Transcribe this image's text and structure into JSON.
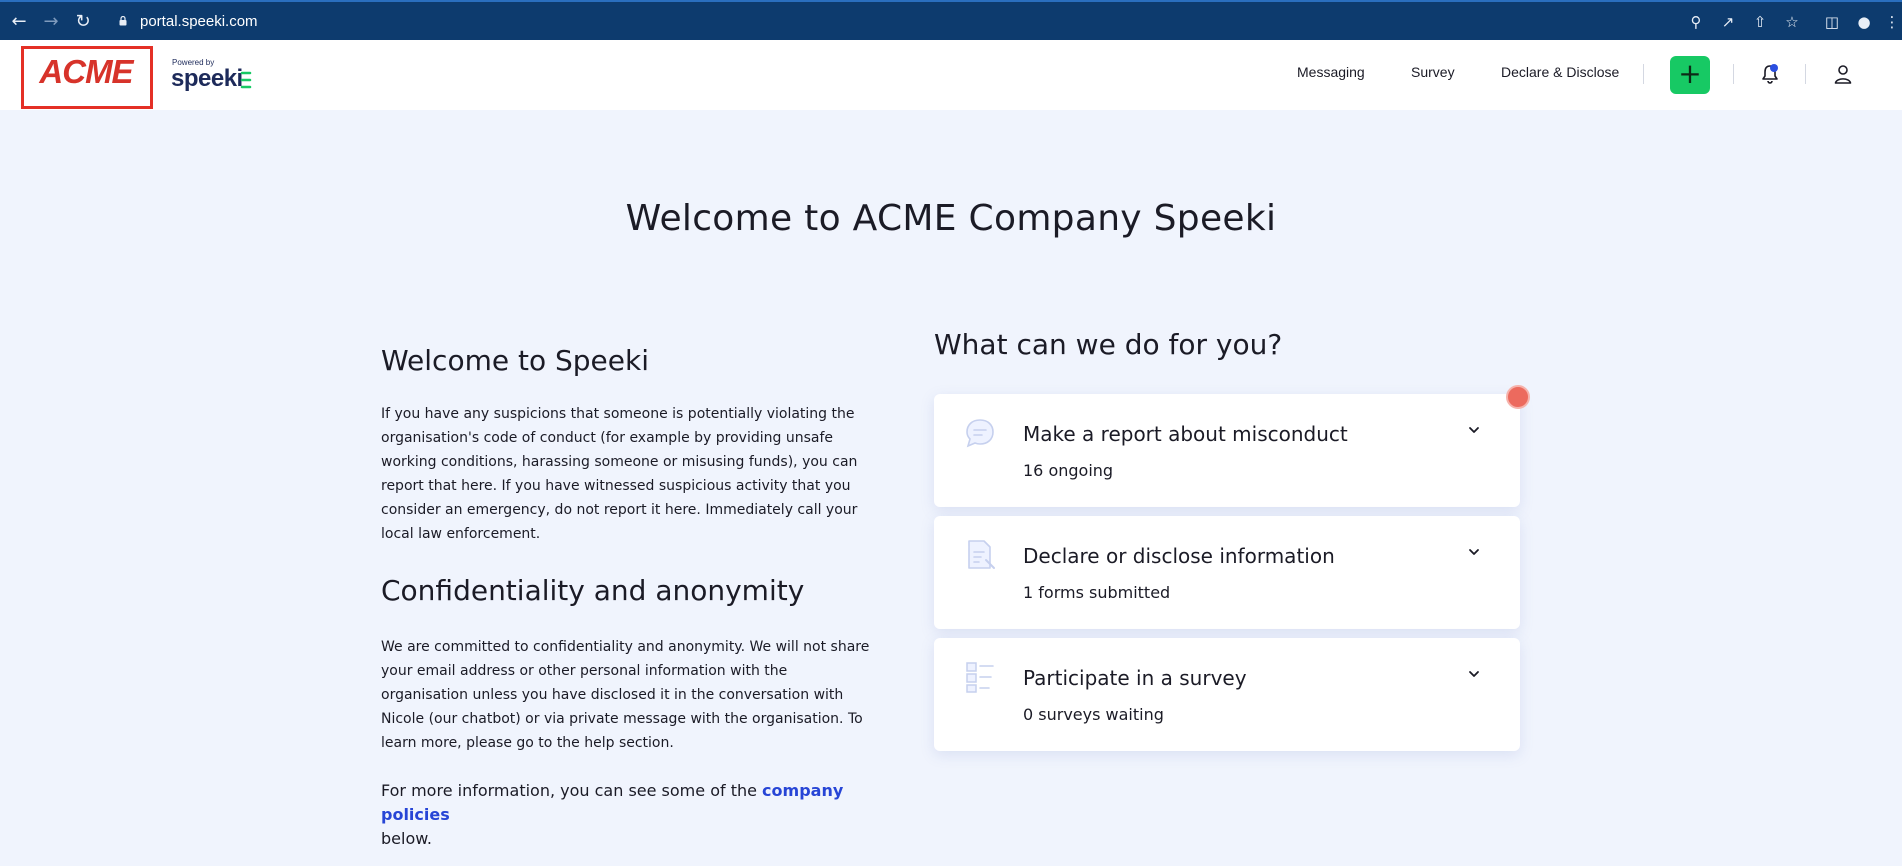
{
  "browser": {
    "url": "portal.speeki.com"
  },
  "header": {
    "logo_text": "ACME",
    "powered_by": "Powered by",
    "brand": "speeki",
    "nav": [
      "Messaging",
      "Survey",
      "Declare & Disclose"
    ],
    "add_label": "+"
  },
  "page": {
    "title": "Welcome to ACME Company Speeki"
  },
  "left": {
    "welcome_heading": "Welcome to Speeki",
    "welcome_text": "If you have any suspicions that someone is potentially violating the organisation's code of conduct (for example by providing unsafe working conditions, harassing someone or misusing funds), you can report that here. If you have witnessed suspicious activity that you consider an emergency, do not report it here. Immediately call your local law enforcement.",
    "conf_heading": "Confidentiality and anonymity",
    "conf_text": "We are committed to confidentiality and anonymity. We will not share your email address or other personal information with the organisation unless you have disclosed it in the conversation with Nicole (our chatbot) or via private message with the organisation. To learn more, please go to the help section.",
    "more_prefix": "For more information, you can see some of the ",
    "more_link": "company policies",
    "more_suffix": "below."
  },
  "right": {
    "title": "What can we do for you?",
    "cards": [
      {
        "title": "Make a report about misconduct",
        "sub": "16 ongoing",
        "icon": "chat-bubble-icon"
      },
      {
        "title": "Declare or disclose information",
        "sub": "1 forms submitted",
        "icon": "document-edit-icon"
      },
      {
        "title": "Participate in a survey",
        "sub": "0 surveys waiting",
        "icon": "checklist-icon"
      }
    ]
  },
  "colors": {
    "accent_green": "#17c964",
    "link_blue": "#2745d6",
    "acme_red": "#d7332a",
    "background": "#f0f4fd"
  }
}
